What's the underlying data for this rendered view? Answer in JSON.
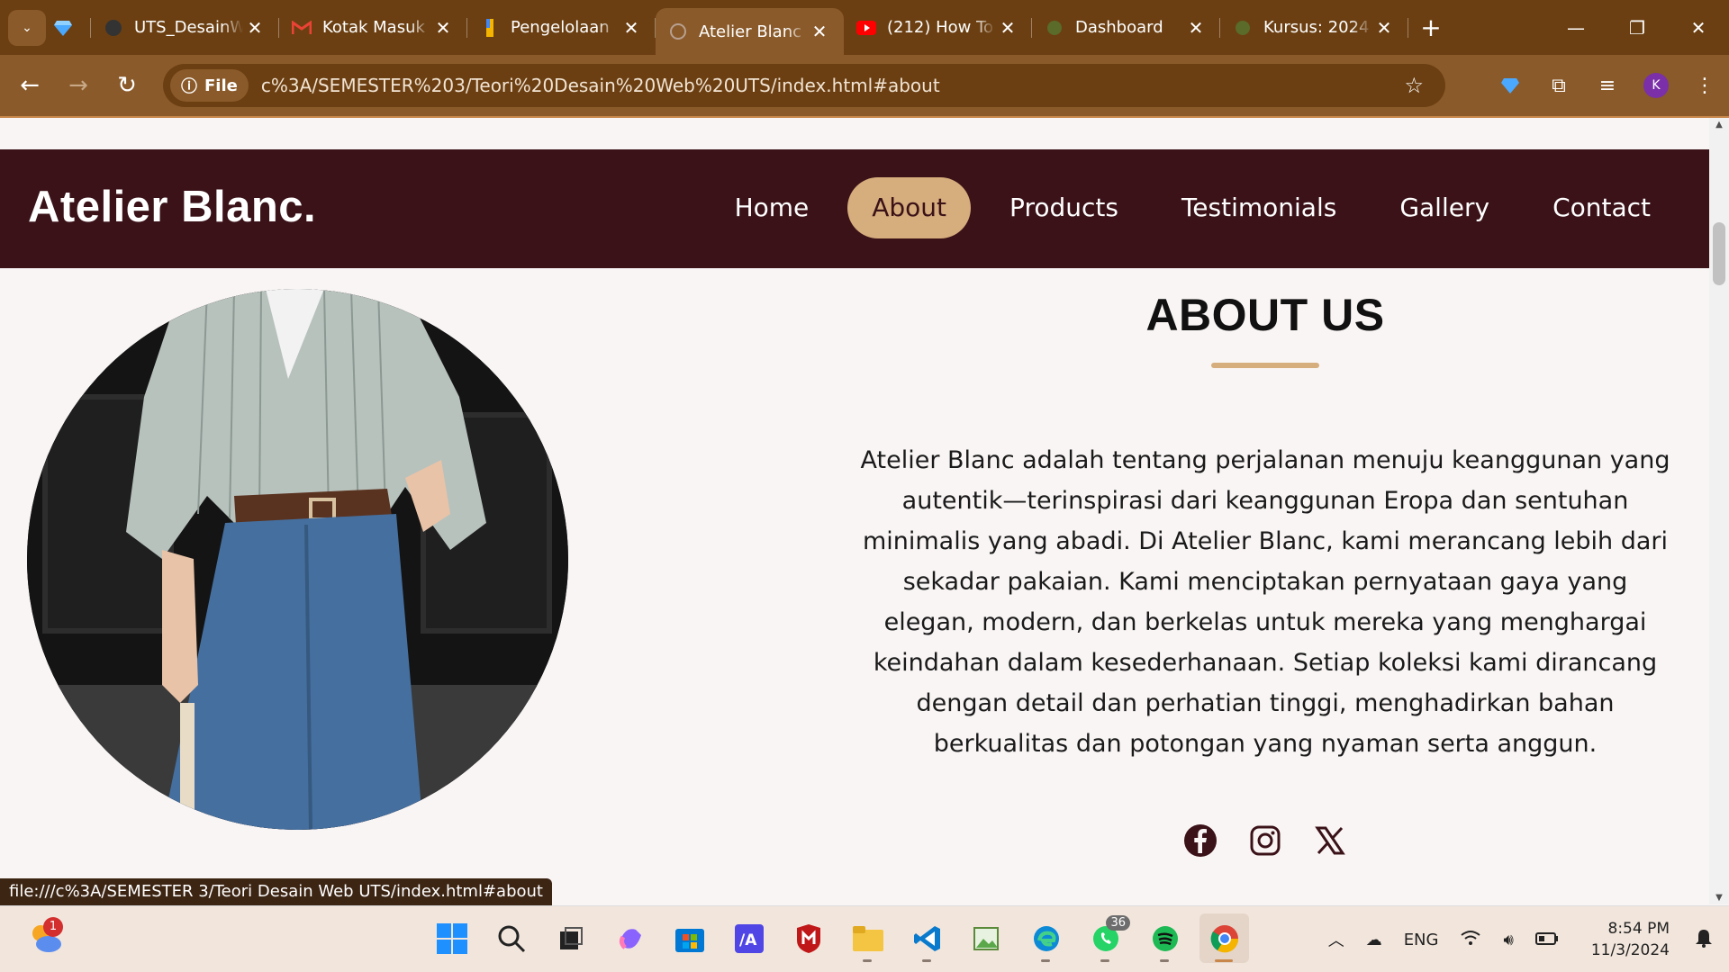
{
  "browser": {
    "tabs": [
      {
        "title": "UTS_DesainWeb",
        "icon": "github-icon"
      },
      {
        "title": "Kotak Masuk",
        "icon": "gmail-icon"
      },
      {
        "title": "Pengelolaan",
        "icon": "drive-icon"
      },
      {
        "title": "Atelier Blanc",
        "icon": "globe-icon",
        "active": true
      },
      {
        "title": "(212) How To",
        "icon": "youtube-icon"
      },
      {
        "title": "Dashboard",
        "icon": "moodle-icon"
      },
      {
        "title": "Kursus: 2024",
        "icon": "moodle-icon"
      }
    ],
    "omnibox": {
      "chip": "File",
      "url": "c%3A/SEMESTER%203/Teori%20Desain%20Web%20UTS/index.html#about"
    },
    "profile_initial": "K",
    "status_url": "file:///c%3A/SEMESTER 3/Teori Desain Web UTS/index.html#about"
  },
  "site": {
    "logo": "Atelier Blanc.",
    "nav": [
      {
        "label": "Home"
      },
      {
        "label": "About",
        "active": true
      },
      {
        "label": "Products"
      },
      {
        "label": "Testimonials"
      },
      {
        "label": "Gallery"
      },
      {
        "label": "Contact"
      }
    ],
    "about": {
      "heading": "ABOUT US",
      "body": "Atelier Blanc adalah tentang perjalanan menuju keanggunan yang autentik—terinspirasi dari keanggunan Eropa dan sentuhan minimalis yang abadi. Di Atelier Blanc, kami merancang lebih dari sekadar pakaian. Kami menciptakan pernyataan gaya yang elegan, modern, dan berkelas untuk mereka yang menghargai keindahan dalam kesederhanaan. Setiap koleksi kami dirancang dengan detail dan perhatian tinggi, menghadirkan bahan berkualitas dan potongan yang nyaman serta anggun.",
      "socials": [
        "facebook-icon",
        "instagram-icon",
        "x-icon"
      ]
    },
    "colors": {
      "nav_bg": "#3a1218",
      "accent": "#d6ad7c",
      "page_bg": "#faf5f5"
    }
  },
  "taskbar": {
    "weather_badge": "1",
    "whatsapp_badge": "36",
    "language": "ENG",
    "time": "8:54 PM",
    "date": "11/3/2024"
  }
}
